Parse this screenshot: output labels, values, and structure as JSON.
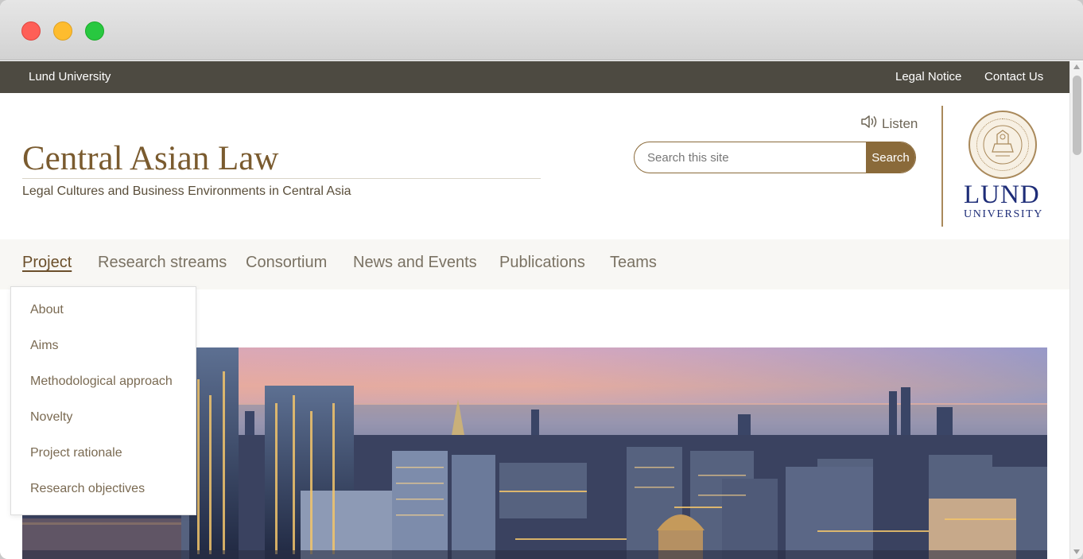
{
  "topbar": {
    "university": "Lund University",
    "legal_notice": "Legal Notice",
    "contact_us": "Contact Us"
  },
  "header": {
    "title": "Central Asian Law",
    "subtitle": "Legal Cultures and Business Environments in Central Asia",
    "listen_label": "Listen",
    "search_placeholder": "Search this site",
    "search_button": "Search",
    "logo_line1": "LUND",
    "logo_line2": "UNIVERSITY"
  },
  "nav": {
    "items": [
      "Project",
      "Research streams",
      "Consortium",
      "News and Events",
      "Publications",
      "Teams"
    ],
    "active": "Project"
  },
  "dropdown": {
    "items": [
      "About",
      "Aims",
      "Methodological approach",
      "Novelty",
      "Project rationale",
      "Research objectives"
    ]
  },
  "colors": {
    "topbar": "#4d4a41",
    "accent_brown": "#8a6a3a",
    "title_brown": "#7a5b2f",
    "lund_blue": "#1e2d78"
  },
  "icons": {
    "listen": "speaker-icon",
    "seal": "university-seal-icon"
  }
}
